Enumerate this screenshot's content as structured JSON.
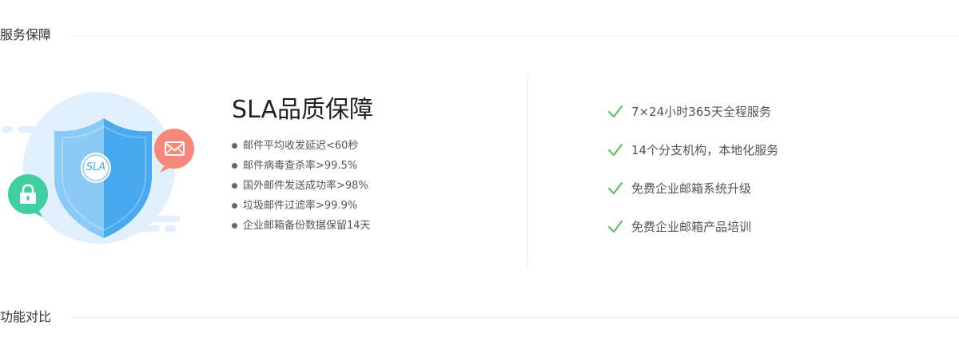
{
  "sections": {
    "service": {
      "title": "服务保障"
    },
    "compare": {
      "title": "功能对比"
    }
  },
  "illustration": {
    "badge_text": "SLA",
    "icons": [
      "shield-icon",
      "mail-icon",
      "lock-icon"
    ],
    "colors": {
      "circle": "#e1f0fc",
      "shield_light": "#8ccaf6",
      "shield_dark": "#48a9ee",
      "mail": "#f5887a",
      "lock": "#40cfa1"
    }
  },
  "sla": {
    "title": "SLA品质保障",
    "items": [
      "邮件平均收发延迟<60秒",
      "邮件病毒查杀率>99.5%",
      "国外邮件发送成功率>98%",
      "垃圾邮件过滤率>99.9%",
      "企业邮箱备份数据保留14天"
    ]
  },
  "services": {
    "check_color": "#5cc25f",
    "items": [
      "7×24小时365天全程服务",
      "14个分支机构，本地化服务",
      "免费企业邮箱系统升级",
      "免费企业邮箱产品培训"
    ]
  }
}
